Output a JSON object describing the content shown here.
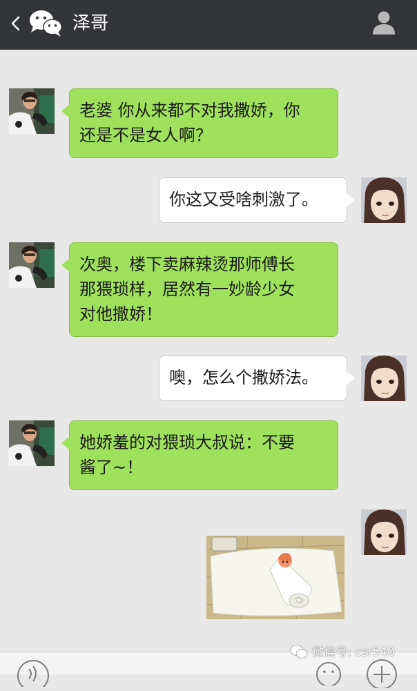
{
  "header": {
    "title": "泽哥"
  },
  "messages": [
    {
      "side": "left",
      "lines": [
        "老婆  你从来都不对我撒娇，你",
        "还是不是女人啊？"
      ]
    },
    {
      "side": "right",
      "lines": [
        "你这又受啥刺激了。"
      ]
    },
    {
      "side": "left",
      "lines": [
        "次奥，楼下卖麻辣烫那师傅长",
        "那猥琐样，居然有一妙龄少女",
        "对他撒娇！"
      ]
    },
    {
      "side": "right",
      "lines": [
        "噢，怎么个撒娇法。"
      ]
    },
    {
      "side": "left",
      "lines": [
        "她娇羞的对猥琐大叔说：不要",
        "酱了~！"
      ]
    },
    {
      "side": "right",
      "type": "image"
    }
  ],
  "watermark": {
    "text": "微信号: csr540"
  },
  "icons": {
    "back": "chevron-left-icon",
    "logo": "wechat-logo-icon",
    "profile": "person-icon",
    "voice": "voice-icon",
    "emoji": "emoji-icon",
    "plus": "plus-icon"
  },
  "colors": {
    "header_bg": "#323438",
    "chat_bg": "#e8e8e8",
    "sent_bubble": "#9fe15c",
    "received_bubble": "#ffffff"
  }
}
